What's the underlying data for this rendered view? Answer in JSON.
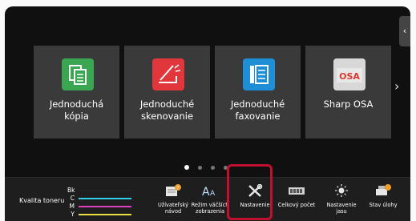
{
  "tiles": [
    {
      "line1": "Jednoduchá",
      "line2": "kópia",
      "icon": "copy-icon",
      "color": "#3aa652"
    },
    {
      "line1": "Jednoduché",
      "line2": "skenovanie",
      "icon": "scan-icon",
      "color": "#e0363c"
    },
    {
      "line1": "Jednoduché",
      "line2": "faxovanie",
      "icon": "fax-icon",
      "color": "#1e8fd6"
    },
    {
      "line1": "Sharp OSA",
      "line2": "",
      "icon": "sharp-osa-logo",
      "color": "#d93a2f"
    }
  ],
  "pager": {
    "pages": 4,
    "active": 1
  },
  "toner": {
    "label": "Kvalita toneru",
    "rows": [
      {
        "code": "Bk",
        "color": "#222222"
      },
      {
        "code": "C",
        "color": "#2fd0e8"
      },
      {
        "code": "M",
        "color": "#e040c0"
      },
      {
        "code": "Y",
        "color": "#e8e040"
      }
    ]
  },
  "bottom_icons": [
    {
      "line1": "Užívateľský",
      "line2": "návod",
      "icon": "manual-icon"
    },
    {
      "line1": "Režim väčších",
      "line2": "zobrazenia",
      "icon": "large-text-icon"
    },
    {
      "line1": "Nastavenie",
      "line2": "",
      "icon": "settings-tools-icon"
    },
    {
      "line1": "Celkový počet",
      "line2": "",
      "icon": "counter-icon"
    },
    {
      "line1": "Nastavenie",
      "line2": "jasu",
      "icon": "brightness-icon"
    },
    {
      "line1": "Stav úlohy",
      "line2": "",
      "icon": "job-status-icon"
    }
  ],
  "side_tab_glyph": "‹",
  "next_glyph": "›",
  "highlight_color": "#c0102e"
}
